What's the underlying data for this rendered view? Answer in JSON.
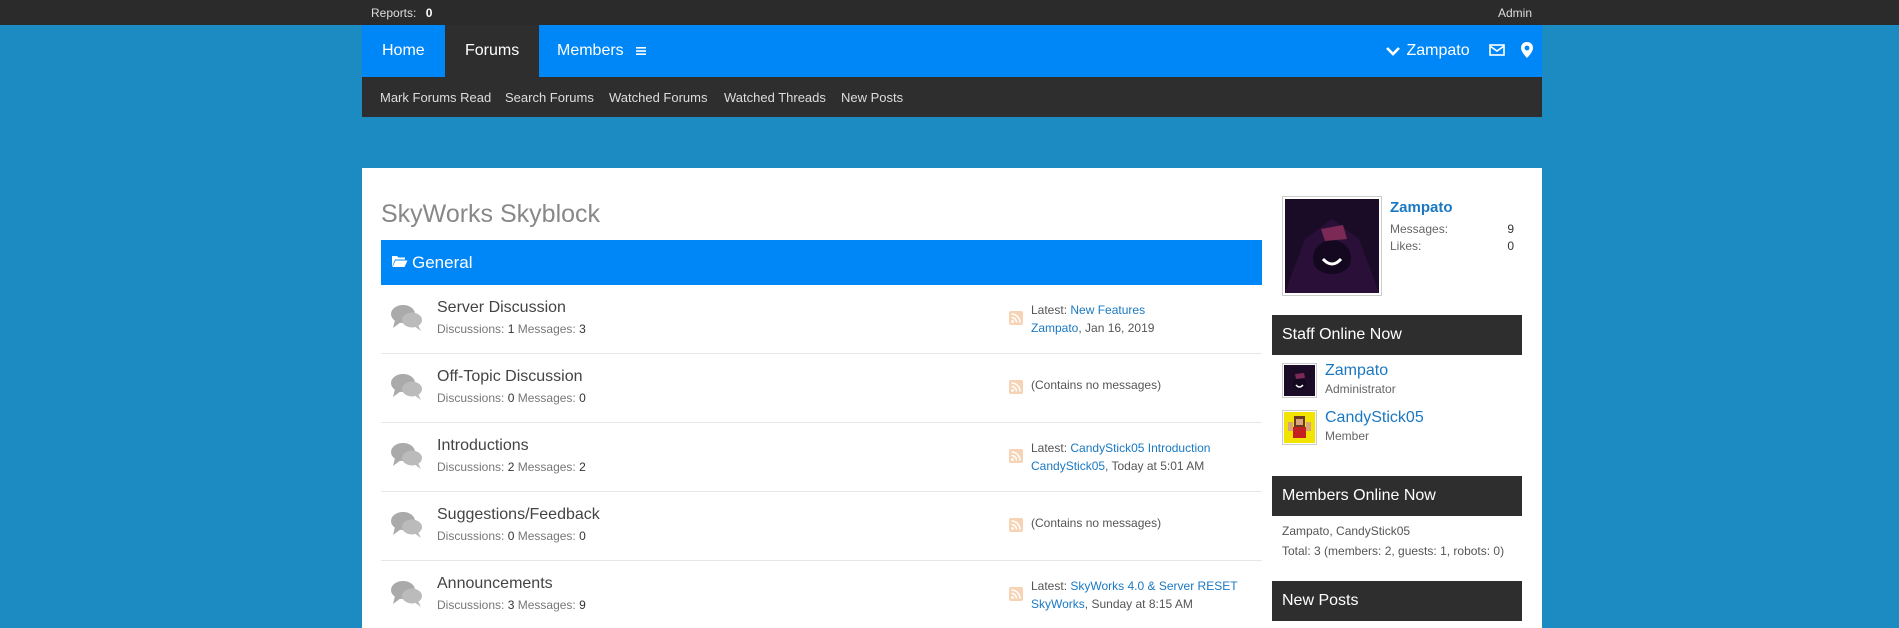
{
  "admin_bar": {
    "reports_label": "Reports:",
    "reports_count": "0",
    "admin_label": "Admin"
  },
  "nav": {
    "tabs": [
      {
        "label": "Home"
      },
      {
        "label": "Forums"
      },
      {
        "label": "Members"
      }
    ],
    "user": "Zampato"
  },
  "subnav": {
    "items": [
      "Mark Forums Read",
      "Search Forums",
      "Watched Forums",
      "Watched Threads",
      "New Posts"
    ]
  },
  "page": {
    "title": "SkyWorks Skyblock"
  },
  "category": {
    "label": "General"
  },
  "forums": [
    {
      "name": "Server Discussion",
      "disc_label": "Discussions:",
      "disc": "1",
      "msg_label": "Messages:",
      "msgs": "3",
      "latest_label": "Latest:",
      "latest_thread": "New Features",
      "latest_user": "Zampato",
      "latest_time": ", Jan 16, 2019"
    },
    {
      "name": "Off-Topic Discussion",
      "disc_label": "Discussions:",
      "disc": "0",
      "msg_label": "Messages:",
      "msgs": "0",
      "none": "(Contains no messages)"
    },
    {
      "name": "Introductions",
      "disc_label": "Discussions:",
      "disc": "2",
      "msg_label": "Messages:",
      "msgs": "2",
      "latest_label": "Latest:",
      "latest_thread": "CandyStick05 Introduction",
      "latest_user": "CandyStick05",
      "latest_time": ", Today at 5:01 AM"
    },
    {
      "name": "Suggestions/Feedback",
      "disc_label": "Discussions:",
      "disc": "0",
      "msg_label": "Messages:",
      "msgs": "0",
      "none": "(Contains no messages)"
    },
    {
      "name": "Announcements",
      "disc_label": "Discussions:",
      "disc": "3",
      "msg_label": "Messages:",
      "msgs": "9",
      "latest_label": "Latest:",
      "latest_thread": "SkyWorks 4.0 & Server RESET",
      "latest_user": "SkyWorks",
      "latest_time": ", Sunday at 8:15 AM"
    }
  ],
  "sidebar": {
    "profile": {
      "name": "Zampato",
      "messages_label": "Messages:",
      "messages": "9",
      "likes_label": "Likes:",
      "likes": "0"
    },
    "staff_title": "Staff Online Now",
    "staff": [
      {
        "name": "Zampato",
        "role": "Administrator"
      },
      {
        "name": "CandyStick05",
        "role": "Member"
      }
    ],
    "members_title": "Members Online Now",
    "members_list": "Zampato, CandyStick05",
    "members_total": "Total: 3 (members: 2, guests: 1, robots: 0)",
    "new_posts_title": "New Posts"
  }
}
